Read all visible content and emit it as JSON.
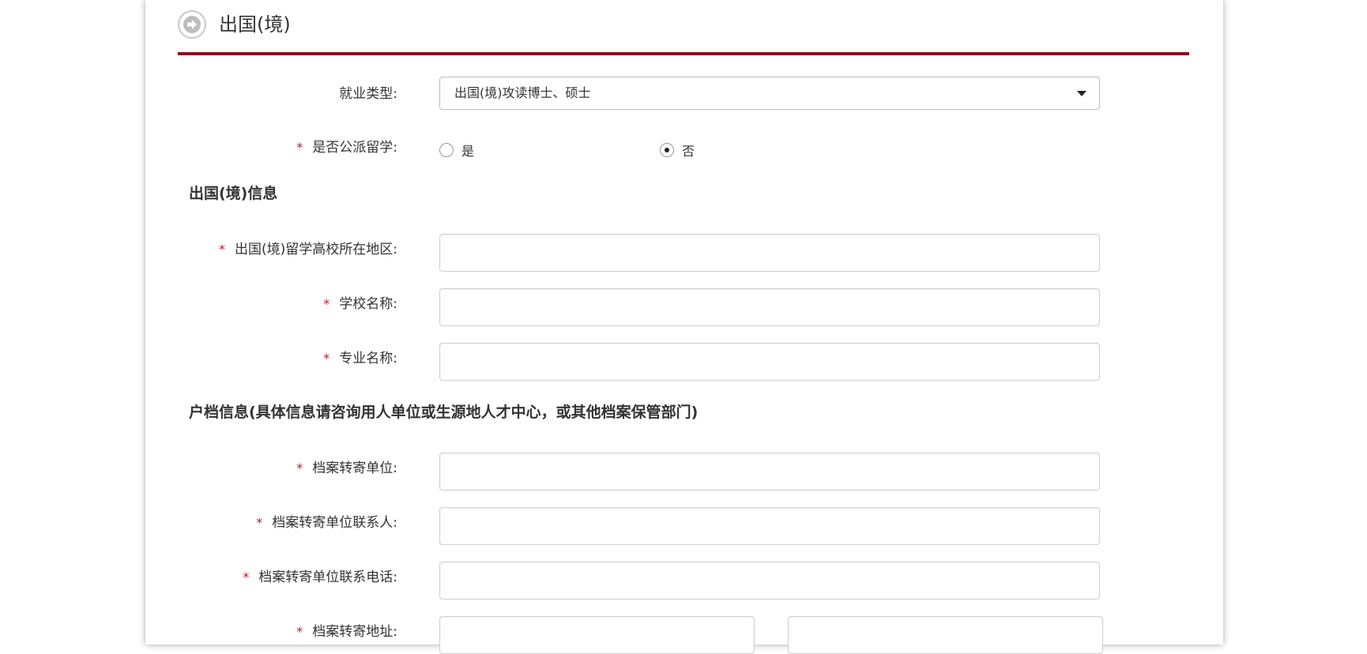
{
  "header": {
    "title": "出国(境)"
  },
  "employment_type": {
    "label": "就业类型:",
    "selected": "出国(境)攻读博士、硕士"
  },
  "public_funded": {
    "required_mark": "*",
    "label": "是否公派留学:",
    "option_yes": "是",
    "option_no": "否",
    "selected": "否"
  },
  "abroad_section": {
    "title": "出国(境)信息",
    "fields": [
      {
        "required_mark": "*",
        "label": "出国(境)留学高校所在地区:",
        "value": ""
      },
      {
        "required_mark": "*",
        "label": "学校名称:",
        "value": ""
      },
      {
        "required_mark": "*",
        "label": "专业名称:",
        "value": ""
      }
    ]
  },
  "archive_section": {
    "title": "户档信息(具体信息请咨询用人单位或生源地人才中心，或其他档案保管部门)",
    "fields": [
      {
        "required_mark": "*",
        "label": "档案转寄单位:",
        "value": ""
      },
      {
        "required_mark": "*",
        "label": "档案转寄单位联系人:",
        "value": ""
      },
      {
        "required_mark": "*",
        "label": "档案转寄单位联系电话:",
        "value": ""
      },
      {
        "required_mark": "*",
        "label": "档案转寄地址:",
        "value_1": "",
        "value_2": ""
      }
    ]
  },
  "colors": {
    "accent": "#8b0d1f",
    "required": "#c0182a"
  }
}
